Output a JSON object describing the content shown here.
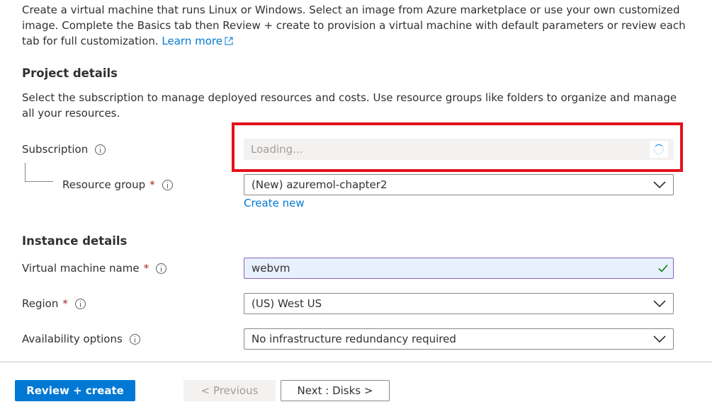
{
  "intro": {
    "text": "Create a virtual machine that runs Linux or Windows. Select an image from Azure marketplace or use your own customized image. Complete the Basics tab then Review + create to provision a virtual machine with default parameters or review each tab for full customization.",
    "learn_more": "Learn more"
  },
  "project_details": {
    "title": "Project details",
    "description": "Select the subscription to manage deployed resources and costs. Use resource groups like folders to organize and manage all your resources.",
    "subscription": {
      "label": "Subscription",
      "value": "Loading..."
    },
    "resource_group": {
      "label": "Resource group",
      "required_mark": "*",
      "value": "(New) azuremol-chapter2",
      "create_new": "Create new"
    }
  },
  "instance_details": {
    "title": "Instance details",
    "vm_name": {
      "label": "Virtual machine name",
      "required_mark": "*",
      "value": "webvm"
    },
    "region": {
      "label": "Region",
      "required_mark": "*",
      "value": "(US) West US"
    },
    "availability": {
      "label": "Availability options",
      "value": "No infrastructure redundancy required"
    }
  },
  "footer": {
    "review_create": "Review + create",
    "previous": "< Previous",
    "next": "Next : Disks >"
  },
  "colors": {
    "accent": "#0078d4",
    "highlight_border": "#e3121b",
    "required": "#a4262c",
    "valid_check": "#107c10"
  },
  "icons": [
    "external-link-icon",
    "info-icon",
    "spinner-icon",
    "chevron-down-icon",
    "checkmark-icon"
  ]
}
